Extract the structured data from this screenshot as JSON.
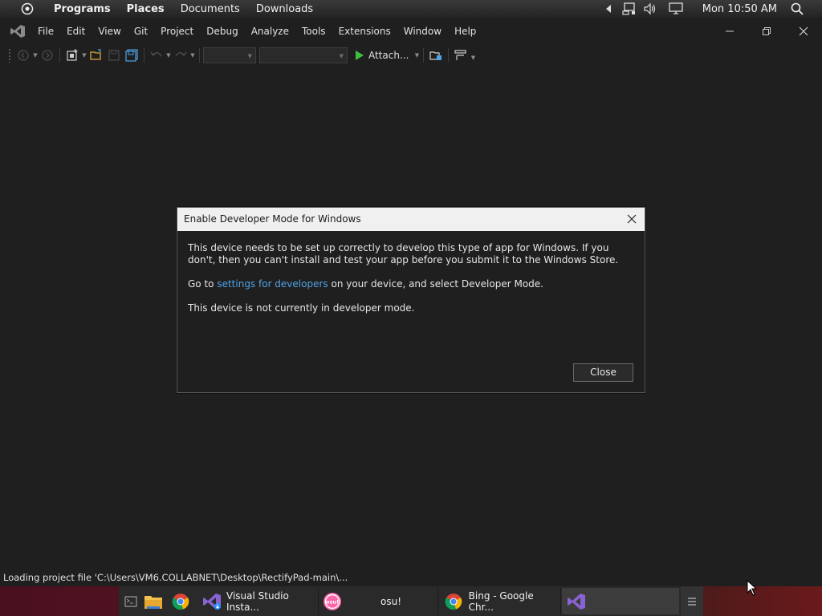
{
  "top_panel": {
    "menus": [
      "Programs",
      "Places",
      "Documents",
      "Downloads"
    ],
    "clock": "Mon 10:50 AM"
  },
  "vs": {
    "menu": [
      "File",
      "Edit",
      "View",
      "Git",
      "Project",
      "Debug",
      "Analyze",
      "Tools",
      "Extensions",
      "Window",
      "Help"
    ],
    "toolbar": {
      "attach_label": "Attach...",
      "config_value": "",
      "platform_value": ""
    }
  },
  "dialog": {
    "title": "Enable Developer Mode for Windows",
    "paragraph1": "This device needs to be set up correctly to develop this type of app for Windows. If you don't, then you can't install and test your app before you submit it to the Windows Store.",
    "goto_prefix": "Go to ",
    "goto_link": "settings for developers",
    "goto_suffix": " on your device, and select Developer Mode.",
    "status": "This device is not currently in developer mode.",
    "close_label": "Close"
  },
  "statusbar": {
    "text": "Loading project file 'C:\\Users\\VM6.COLLABNET\\Desktop\\RectifyPad-main\\..."
  },
  "taskbar": {
    "items": [
      {
        "label": "",
        "icon": "terminal-icon"
      },
      {
        "label": "",
        "icon": "file-manager-icon"
      },
      {
        "label": "",
        "icon": "chrome-icon"
      },
      {
        "label": "Visual Studio Insta...",
        "icon": "vs-installer-icon"
      },
      {
        "label": "osu!",
        "icon": "osu-icon"
      },
      {
        "label": "Bing - Google Chr...",
        "icon": "chrome-icon"
      },
      {
        "label": "",
        "icon": "visual-studio-icon"
      }
    ]
  },
  "colors": {
    "background": "#1f1f1f",
    "link": "#4fa3e8",
    "play": "#3fbf3f",
    "vs_purple": "#8a63d2"
  }
}
